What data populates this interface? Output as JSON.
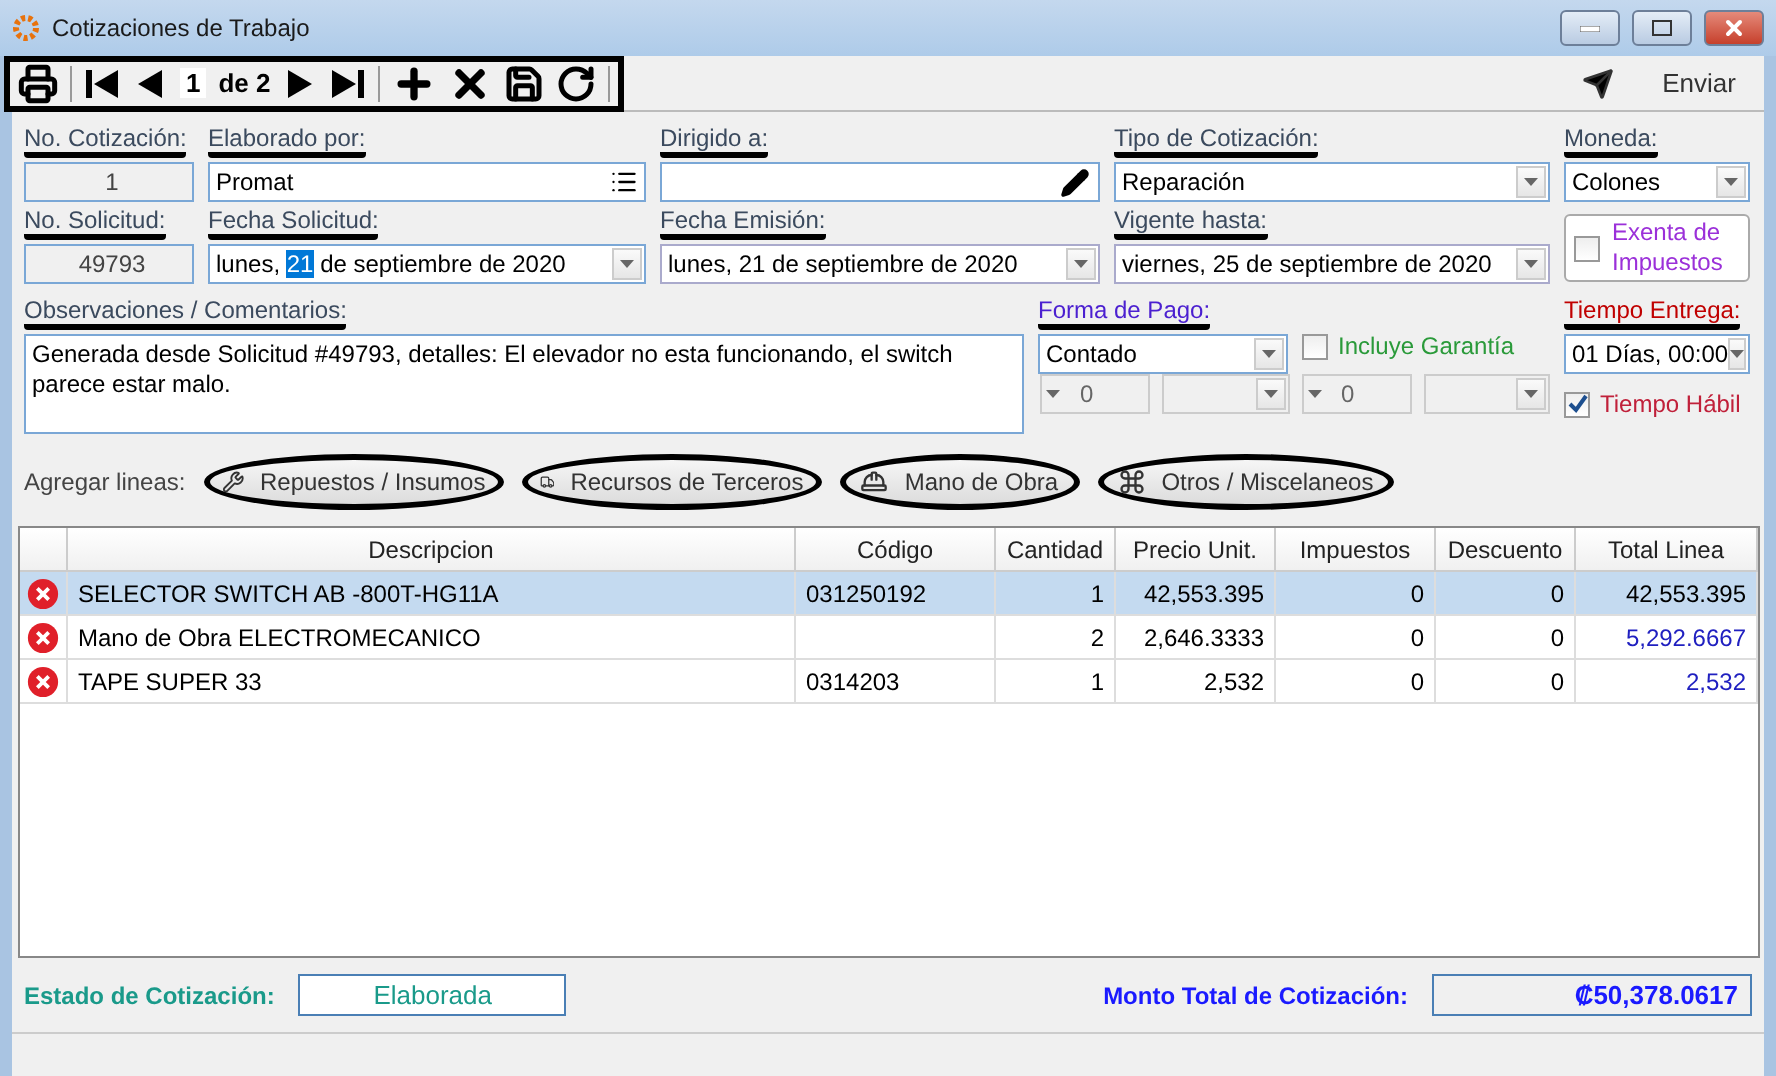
{
  "window": {
    "title": "Cotizaciones de Trabajo"
  },
  "toolbar": {
    "page": "1",
    "page_of": "de 2",
    "send": "Enviar"
  },
  "row1": {
    "no_cotizacion": {
      "label": "No. Cotización:",
      "value": "1"
    },
    "elaborado": {
      "label": "Elaborado por:",
      "value": "Promat"
    },
    "dirigido": {
      "label": "Dirigido a:"
    },
    "tipo": {
      "label": "Tipo de Cotización:",
      "value": "Reparación"
    },
    "moneda": {
      "label": "Moneda:",
      "value": "Colones"
    }
  },
  "row2": {
    "no_solicitud": {
      "label": "No. Solicitud:",
      "value": "49793"
    },
    "fecha_solicitud": {
      "label": "Fecha Solicitud:",
      "segments": [
        {
          "text": "lunes,",
          "selected": false
        },
        {
          "text": "21",
          "selected": true
        },
        {
          "text": "de septiembre de 2020",
          "selected": false
        }
      ]
    },
    "fecha_emision": {
      "label": "Fecha Emisión:",
      "value": "lunes, 21 de septiembre de 2020"
    },
    "vigente": {
      "label": "Vigente hasta:",
      "value": "viernes, 25 de septiembre de 2020"
    },
    "exenta": {
      "label": "Exenta de Impuestos",
      "checked": false
    }
  },
  "observaciones": {
    "label": "Observaciones / Comentarios:",
    "value": "Generada desde Solicitud #49793, detalles: El elevador no esta funcionando, el switch parece estar malo."
  },
  "forma_pago": {
    "label": "Forma de Pago:",
    "value": "Contado",
    "spinners": [
      "0",
      "0"
    ]
  },
  "garantia": {
    "label": "Incluye Garantía",
    "checked": false
  },
  "tiempo_entrega": {
    "label": "Tiempo Entrega:",
    "value": "01 Días, 00:00"
  },
  "tiempo_habil": {
    "label": "Tiempo Hábil",
    "checked": true
  },
  "agregar": {
    "label": "Agregar lineas:",
    "buttons": [
      {
        "kind": "parts",
        "label": "Repuestos / Insumos"
      },
      {
        "kind": "third",
        "label": "Recursos de Terceros"
      },
      {
        "kind": "labor",
        "label": "Mano de Obra"
      },
      {
        "kind": "other",
        "label": "Otros / Miscelaneos"
      }
    ]
  },
  "table": {
    "columns": [
      "Descripcion",
      "Código",
      "Cantidad",
      "Precio Unit.",
      "Impuestos",
      "Descuento",
      "Total Linea"
    ],
    "rows": [
      {
        "selected": true,
        "cells": [
          "SELECTOR SWITCH AB -800T-HG11A",
          "031250192",
          "1",
          "42,553.395",
          "0",
          "0",
          "42,553.395"
        ]
      },
      {
        "selected": false,
        "cells": [
          "Mano de Obra ELECTROMECANICO",
          "",
          "2",
          "2,646.3333",
          "0",
          "0",
          "5,292.6667"
        ]
      },
      {
        "selected": false,
        "cells": [
          "TAPE SUPER 33",
          "0314203",
          "1",
          "2,532",
          "0",
          "0",
          "2,532"
        ]
      }
    ]
  },
  "footer": {
    "estado_label": "Estado de Cotización:",
    "estado": "Elaborada",
    "monto_label": "Monto Total de Cotización:",
    "monto": "₡50,378.0617"
  }
}
